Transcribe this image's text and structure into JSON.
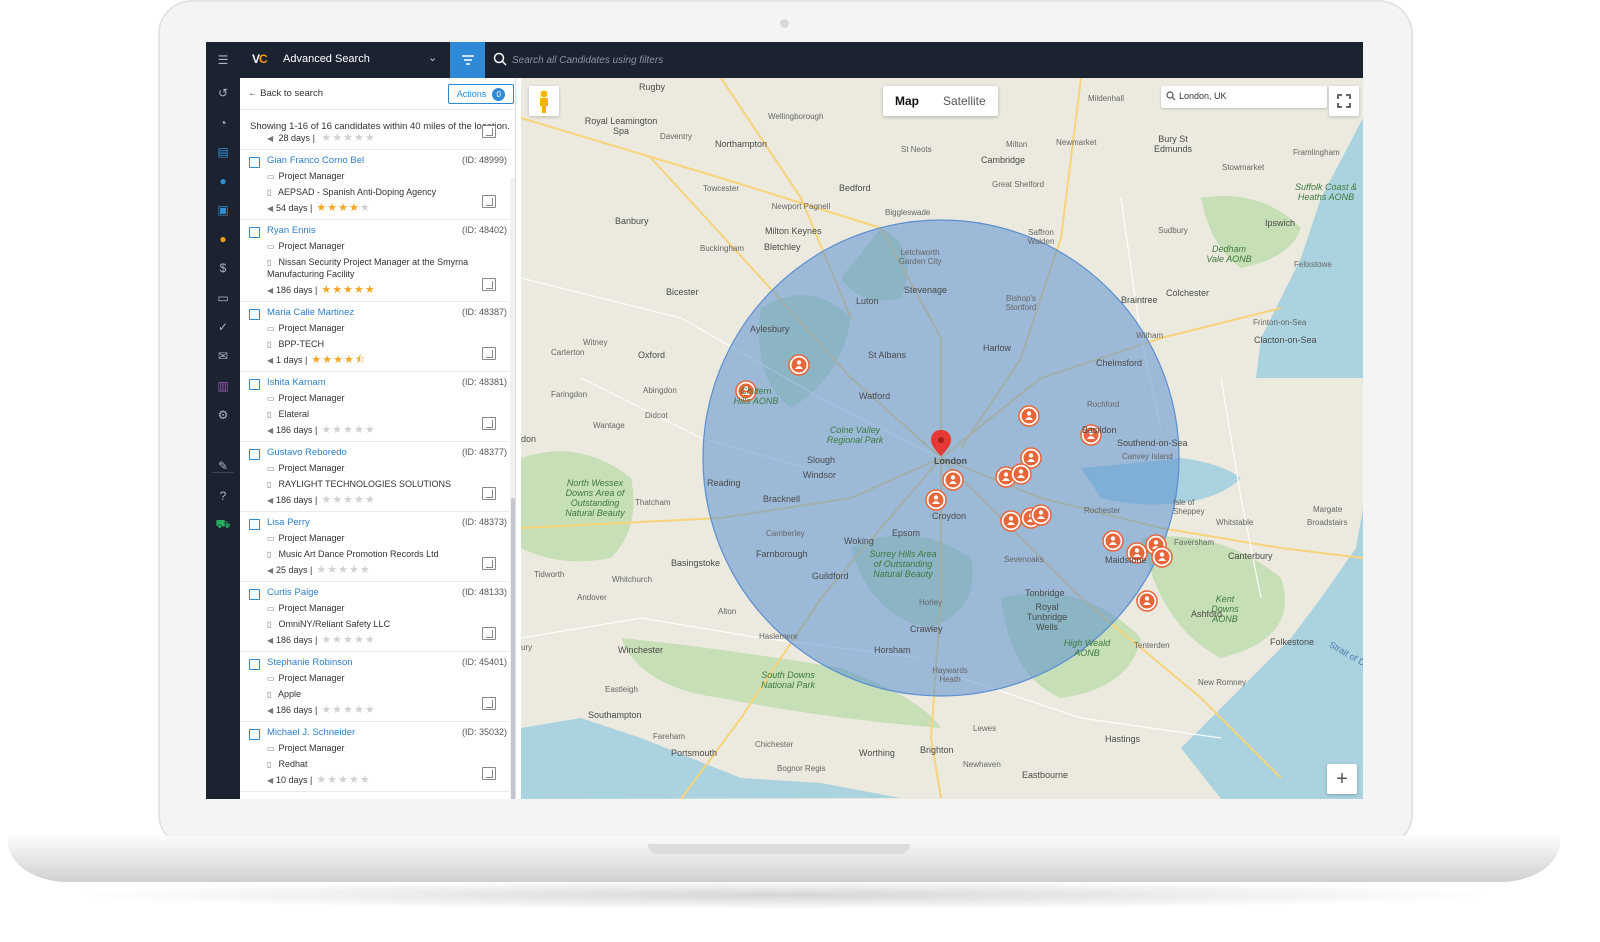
{
  "app": {
    "title": "Advanced Search",
    "search_placeholder": "Search all Candidates using filters"
  },
  "panel": {
    "back_label": "Back to search",
    "actions_label": "Actions",
    "actions_count": "0",
    "showing_text": "Showing 1-16 of 16 candidates within 40 miles of the location."
  },
  "partial_row": {
    "days": "28 days",
    "rating": 0
  },
  "candidates": [
    {
      "name": "Gian Franco Corno Bel",
      "id": "(ID: 48999)",
      "title": "Project Manager",
      "company": "AEPSAD - Spanish Anti-Doping Agency",
      "days": "54 days",
      "rating": 4
    },
    {
      "name": "Ryan Ennis",
      "id": "(ID: 48402)",
      "title": "Project Manager",
      "company": "Nissan Security Project Manager at the Smyrna",
      "company2": "Manufacturing Facility",
      "days": "186 days",
      "rating": 5
    },
    {
      "name": "Maria Calle Martinez",
      "id": "(ID: 48387)",
      "title": "Project Manager",
      "company": "BPP-TECH",
      "days": "1 days",
      "rating": 4.5
    },
    {
      "name": "Ishita Karnam",
      "id": "(ID: 48381)",
      "title": "Project Manager",
      "company": "Elateral",
      "days": "186 days",
      "rating": 0
    },
    {
      "name": "Gustavo Reboredo",
      "id": "(ID: 48377)",
      "title": "Project Manager",
      "company": "RAYLIGHT TECHNOLOGIES SOLUTIONS",
      "days": "186 days",
      "rating": 0
    },
    {
      "name": "Lisa Perry",
      "id": "(ID: 48373)",
      "title": "Project Manager",
      "company": "Music Art Dance Promotion Records Ltd",
      "days": "25 days",
      "rating": 0
    },
    {
      "name": "Curtis Paige",
      "id": "(ID: 48133)",
      "title": "Project Manager",
      "company": "OmniNY/Reliant Safety LLC",
      "days": "186 days",
      "rating": 0
    },
    {
      "name": "Stephanie Robinson",
      "id": "(ID: 45401)",
      "title": "Project Manager",
      "company": "Apple",
      "days": "186 days",
      "rating": 0
    },
    {
      "name": "Michael J. Schneider",
      "id": "(ID: 35032)",
      "title": "Project Manager",
      "company": "Redhat",
      "days": "10 days",
      "rating": 0
    }
  ],
  "map": {
    "type_map": "Map",
    "type_satellite": "Satellite",
    "active_type": "Map",
    "location": "London, UK",
    "zoom_label": "+",
    "circle_color": "#5b8fd0",
    "marker_color": "#e8663a"
  },
  "places": {
    "rugby": "Rugby",
    "leamington": "Royal Leamington Spa",
    "daventry": "Daventry",
    "wellingborough": "Wellingborough",
    "northampton": "Northampton",
    "mildenhall": "Mildenhall",
    "bury": "Bury St Edmunds",
    "newmarket": "Newmarket",
    "stneots": "St Neots",
    "cambridge": "Cambridge",
    "milton": "Milton",
    "framlingham": "Framlingham",
    "towcester": "Towcester",
    "bedford": "Bedford",
    "stowmarket": "Stowmarket",
    "newport": "Newport Pagnell",
    "miltonkeynes": "Milton Keynes",
    "banbury": "Banbury",
    "buckingham": "Buckingham",
    "bletchley": "Bletchley",
    "biggleswade": "Biggleswade",
    "greatshelford": "Great Shelford",
    "saffron": "Saffron Walden",
    "ipswich": "Ipswich",
    "suffolk": "Suffolk Coast & Heaths AONB",
    "dedham": "Dedham Vale AONB",
    "felixstowe": "Felixstowe",
    "sudbury": "Sudbury",
    "letchworth": "Letchworth Garden City",
    "stevenage": "Stevenage",
    "luton": "Luton",
    "bicester": "Bicester",
    "aylesbury": "Aylesbury",
    "bishops": "Bishop's Stortford",
    "braintree": "Braintree",
    "colchester": "Colchester",
    "witney": "Witney",
    "oxford": "Oxford",
    "carterton": "Carterton",
    "stalbans": "St Albans",
    "harlow": "Harlow",
    "chelmsford": "Chelmsford",
    "clacton": "Clacton-on-Sea",
    "frinton": "Frinton-on-Sea",
    "witham": "Witham",
    "abingdon": "Abingdon",
    "faringdon": "Faringdon",
    "watford": "Watford",
    "chiltern": "Chiltern Hills AONB",
    "didcot": "Didcot",
    "wantage": "Wantage",
    "colne": "Colne Valley Regional Park",
    "basildon": "Basildon",
    "southend": "Southend-on-Sea",
    "canvey": "Canvey Island",
    "slough": "Slough",
    "windsor": "Windsor",
    "london": "London",
    "reading": "Reading",
    "bracknell": "Bracknell",
    "northwessex": "North Wessex Downs Area of Outstanding Natural Beauty",
    "thatcham": "Thatcham",
    "croydon": "Croydon",
    "epsom": "Epsom",
    "camberley": "Camberley",
    "woking": "Woking",
    "farnborough": "Farnborough",
    "rochester": "Rochester",
    "sheppey": "Isle of Sheppey",
    "margate": "Margate",
    "broadstairs": "Broadstairs",
    "whitstable": "Whitstable",
    "faversham": "Faversham",
    "canterbury": "Canterbury",
    "maidstone": "Maidstone",
    "sevenoaks": "Sevenoaks",
    "basingstoke": "Basingstoke",
    "tidworth": "Tidworth",
    "whitchurch": "Whitchurch",
    "guildford": "Guildford",
    "surrey": "Surrey Hills Area of Outstanding Natural Beauty",
    "tonbridge": "Tonbridge",
    "tunbridge": "Royal Tunbridge Wells",
    "horley": "Horley",
    "crawley": "Crawley",
    "andover": "Andover",
    "alton": "Alton",
    "winchester": "Winchester",
    "haslemere": "Haslemere",
    "horsham": "Horsham",
    "highweald": "High Weald AONB",
    "tenterden": "Tenterden",
    "kentdowns": "Kent Downs AONB",
    "ashford": "Ashford",
    "folkestone": "Folkestone",
    "haywards": "Haywards Heath",
    "southdowns": "South Downs National Park",
    "eastleigh": "Eastleigh",
    "southampton": "Southampton",
    "fareham": "Fareham",
    "portsmouth": "Portsmouth",
    "chichester": "Chichester",
    "worthing": "Worthing",
    "brighton": "Brighton",
    "lewes": "Lewes",
    "hastings": "Hastings",
    "bognor": "Bognor Regis",
    "newhaven": "Newhaven",
    "eastbourne": "Eastbourne",
    "romney": "New Romney",
    "strait": "Strait of Dover",
    "don": "don",
    "ury": "ury",
    "ochford": "Rochford"
  }
}
